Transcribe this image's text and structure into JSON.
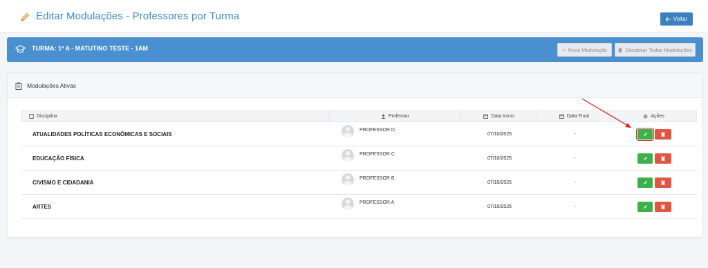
{
  "header": {
    "title": "Editar Modulações - Professores por Turma",
    "back_label": "Voltar",
    "back_icon": "arrow-left-icon",
    "accent": "#3b8ccc"
  },
  "class_bar": {
    "title": "TURMA: 1ª A - MATUTINO TESTE - 1AM",
    "new_label": "Nova Modulação",
    "deactivate_label": "Desativar Todas Modulações",
    "color": "#4a8fd0"
  },
  "panel": {
    "title": "Modulações Ativas"
  },
  "table": {
    "columns": {
      "disciplina": "Disciplina",
      "professor": "Professor",
      "data_inicio": "Data Início",
      "data_final": "Data Final",
      "acoes": "Ações"
    },
    "rows": [
      {
        "disciplina": "ATUALIDADES POLÍTICAS ECONÔMICAS E SOCIAIS",
        "professor": "PROFESSOR D",
        "data_inicio": "07/10/2025",
        "data_final": "-"
      },
      {
        "disciplina": "EDUCAÇÃO FÍSICA",
        "professor": "PROFESSOR C",
        "data_inicio": "07/10/2025",
        "data_final": "-"
      },
      {
        "disciplina": "CIVISMO E CIDADANIA",
        "professor": "PROFESSOR B",
        "data_inicio": "07/10/2025",
        "data_final": "-"
      },
      {
        "disciplina": "ARTES",
        "professor": "PROFESSOR A",
        "data_inicio": "07/10/2025",
        "data_final": "-"
      }
    ]
  },
  "colors": {
    "edit": "#3db149",
    "delete": "#e05544",
    "annotation": "#e02020"
  }
}
